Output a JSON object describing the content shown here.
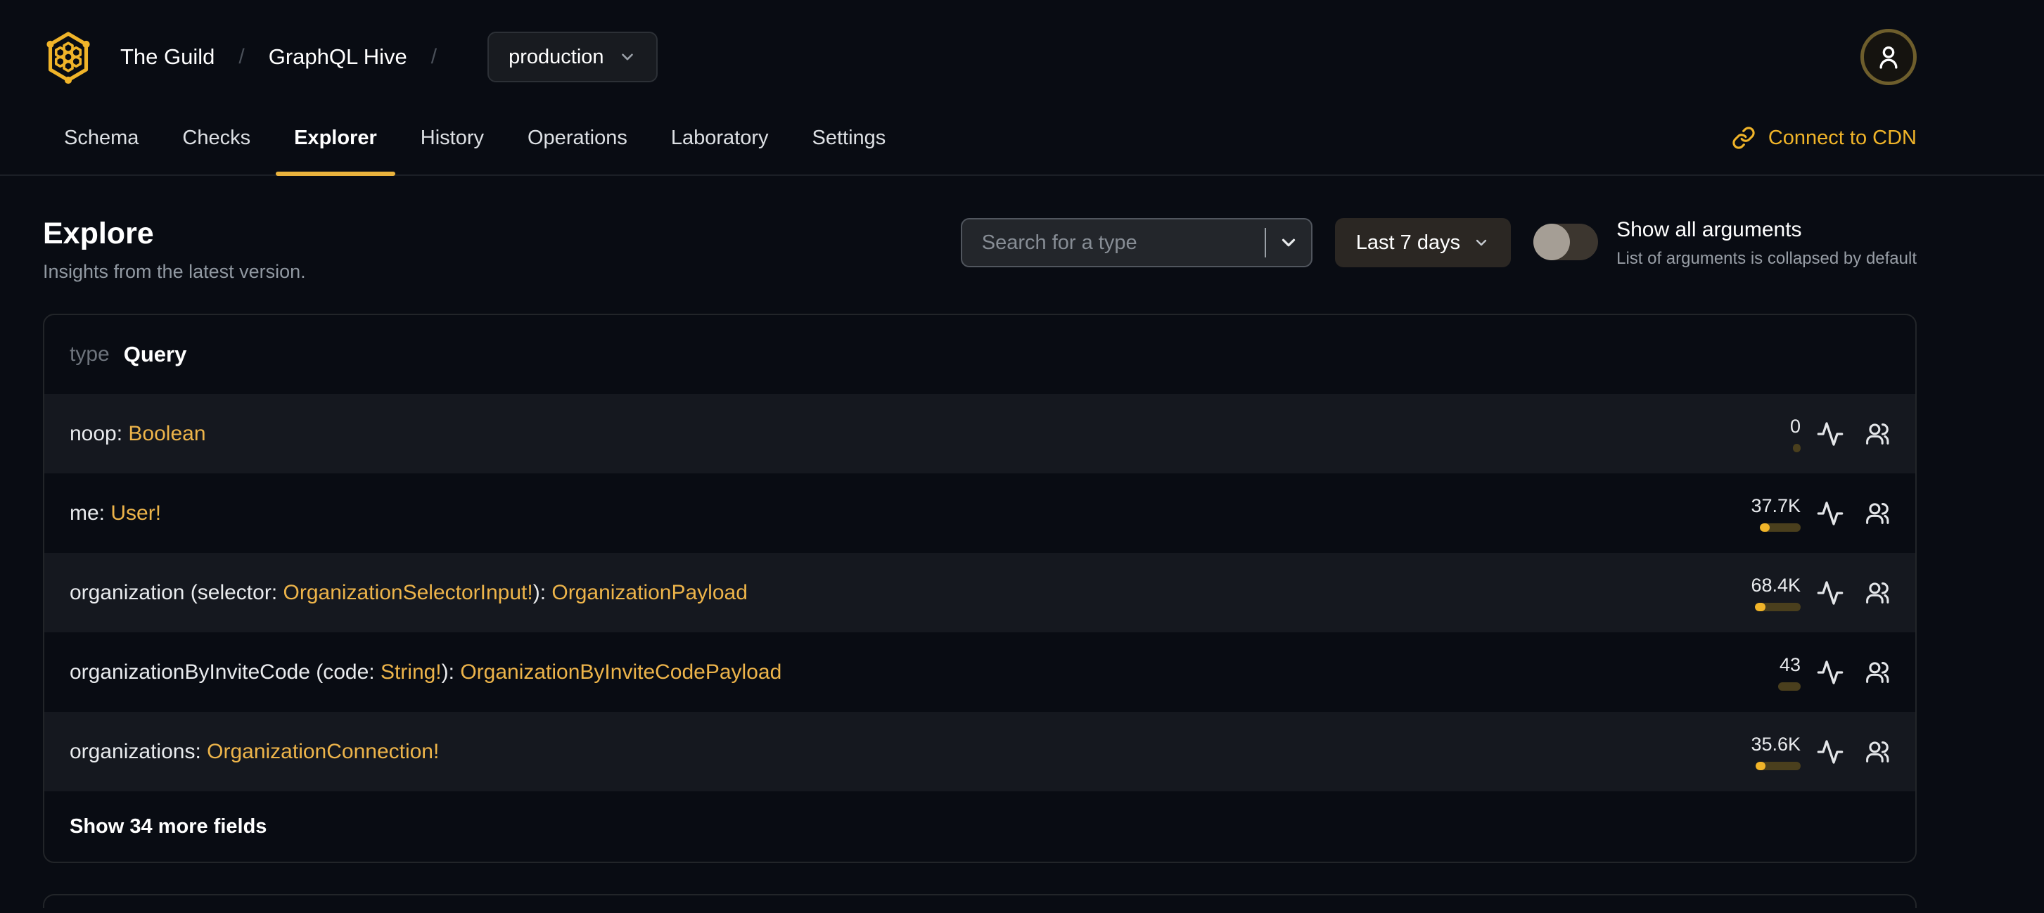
{
  "colors": {
    "accent": "#f0b429",
    "type_text_amber": "#edb44a",
    "bar_track": "#4a3f1d",
    "bar_fill": "#f0b429",
    "page_bg": "#090c13",
    "row_alt_bg": "#1a1b1f"
  },
  "header": {
    "logo_icon": "hive-honeycomb-logo",
    "breadcrumb": {
      "org": "The Guild",
      "separator": "/",
      "project": "GraphQL Hive",
      "target": "production"
    },
    "avatar_icon": "user-icon",
    "tabs": [
      {
        "label": "Schema",
        "active": false
      },
      {
        "label": "Checks",
        "active": false
      },
      {
        "label": "Explorer",
        "active": true
      },
      {
        "label": "History",
        "active": false
      },
      {
        "label": "Operations",
        "active": false
      },
      {
        "label": "Laboratory",
        "active": false
      },
      {
        "label": "Settings",
        "active": false
      }
    ],
    "cdn_link": {
      "icon": "link-icon",
      "label": "Connect to CDN"
    }
  },
  "page": {
    "title": "Explore",
    "subtitle": "Insights from the latest version."
  },
  "controls": {
    "type_search": {
      "placeholder": "Search for a type"
    },
    "period": {
      "value": "Last 7 days"
    },
    "arguments_toggle": {
      "on": false,
      "label": "Show all arguments",
      "caption": "List of arguments is collapsed by default"
    }
  },
  "type_card": {
    "kind": "type",
    "name": "Query",
    "fields": [
      {
        "parts": [
          {
            "t": "noop: "
          },
          {
            "t": "Boolean",
            "k": "type"
          }
        ],
        "count": "0",
        "bar": {
          "w": 11,
          "fill": 0
        }
      },
      {
        "parts": [
          {
            "t": "me: "
          },
          {
            "t": "User!",
            "k": "type"
          }
        ],
        "count": "37.7K",
        "bar": {
          "w": 58,
          "fill": 14
        }
      },
      {
        "parts": [
          {
            "t": "organization (selector: "
          },
          {
            "t": "OrganizationSelectorInput!",
            "k": "type"
          },
          {
            "t": "): "
          },
          {
            "t": "OrganizationPayload",
            "k": "type"
          }
        ],
        "count": "68.4K",
        "bar": {
          "w": 65,
          "fill": 15
        }
      },
      {
        "parts": [
          {
            "t": "organizationByInviteCode (code: "
          },
          {
            "t": "String!",
            "k": "type"
          },
          {
            "t": "): "
          },
          {
            "t": "OrganizationByInviteCodePayload",
            "k": "type"
          }
        ],
        "count": "43",
        "bar": {
          "w": 32,
          "fill": 0
        }
      },
      {
        "parts": [
          {
            "t": "organizations: "
          },
          {
            "t": "OrganizationConnection!",
            "k": "type"
          }
        ],
        "count": "35.6K",
        "bar": {
          "w": 64,
          "fill": 14
        }
      }
    ],
    "show_more_label": "Show 34 more fields"
  }
}
